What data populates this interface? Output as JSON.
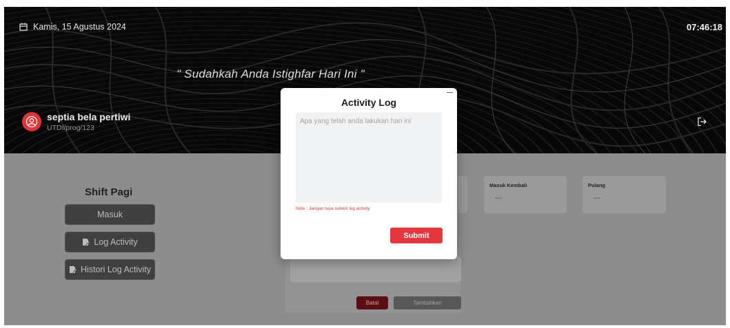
{
  "header": {
    "date": "Kamis, 15 Agustus 2024",
    "time": "07:46:18",
    "quote": "\" Sudahkah Anda Istighfar Hari Ini \"",
    "user_name": "septia bela pertiwi",
    "user_id": "UTDI/prog/123"
  },
  "shift": {
    "title": "Shift Pagi",
    "buttons": {
      "masuk": "Masuk",
      "log_activity": "Log Activity",
      "histori": "Histori Log Activity"
    }
  },
  "cards": [
    {
      "label": "Masuk Kembali",
      "value": "---"
    },
    {
      "label": "Pulang",
      "value": "---"
    }
  ],
  "background_form": {
    "batal": "Batal",
    "tambahkan": "Tambahkan"
  },
  "modal": {
    "title": "Activity Log",
    "placeholder": "Apa yang telah anda lakukan hari ini",
    "note": "Note : Jangan lupa submit log activity",
    "submit": "Submit"
  },
  "colors": {
    "accent_red": "#e4363d",
    "overlay_gray": "#8d8d8d"
  }
}
